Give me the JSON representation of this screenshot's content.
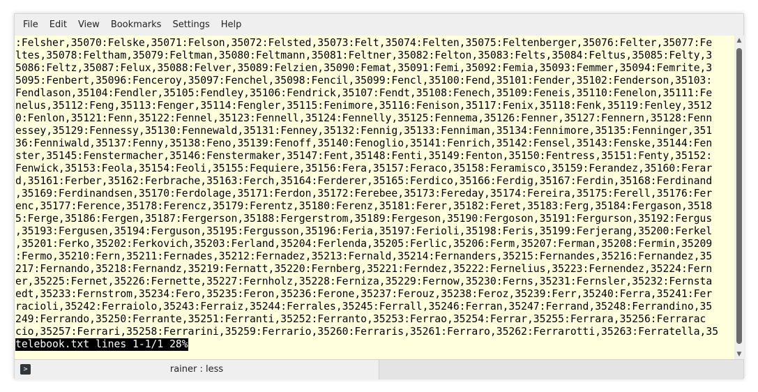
{
  "menubar": {
    "items": [
      {
        "label": "File"
      },
      {
        "label": "Edit"
      },
      {
        "label": "View"
      },
      {
        "label": "Bookmarks"
      },
      {
        "label": "Settings"
      },
      {
        "label": "Help"
      }
    ]
  },
  "terminal": {
    "lines": [
      ":Felsher,35070:Felske,35071:Felson,35072:Felsted,35073:Felt,35074:Felten,35075:Feltenberger,35076:Felter,35077:Fe",
      "ltes,35078:Feltham,35079:Feltman,35080:Feltmann,35081:Feltner,35082:Felton,35083:Felts,35084:Feltus,35085:Felty,3",
      "5086:Feltz,35087:Felux,35088:Felver,35089:Felzien,35090:Femat,35091:Femi,35092:Femia,35093:Femmer,35094:Femrite,3",
      "5095:Fenbert,35096:Fenceroy,35097:Fenchel,35098:Fencil,35099:Fencl,35100:Fend,35101:Fender,35102:Fenderson,35103:",
      "Fendlason,35104:Fendler,35105:Fendley,35106:Fendrick,35107:Fendt,35108:Fenech,35109:Feneis,35110:Fenelon,35111:Fe",
      "nelus,35112:Feng,35113:Fenger,35114:Fengler,35115:Fenimore,35116:Fenison,35117:Fenix,35118:Fenk,35119:Fenley,3512",
      "0:Fenlon,35121:Fenn,35122:Fennel,35123:Fennell,35124:Fennelly,35125:Fennema,35126:Fenner,35127:Fennern,35128:Fenn",
      "essey,35129:Fennessy,35130:Fennewald,35131:Fenney,35132:Fennig,35133:Fenniman,35134:Fennimore,35135:Fenninger,351",
      "36:Fenniwald,35137:Fenny,35138:Feno,35139:Fenoff,35140:Fenoglio,35141:Fenrich,35142:Fensel,35143:Fenske,35144:Fen",
      "ster,35145:Fenstermacher,35146:Fenstermaker,35147:Fent,35148:Fenti,35149:Fenton,35150:Fentress,35151:Fenty,35152:",
      "Fenwick,35153:Feola,35154:Feoli,35155:Fequiere,35156:Fera,35157:Feraco,35158:Feramisco,35159:Ferandez,35160:Ferar",
      "d,35161:Ferber,35162:Ferbrache,35163:Ferch,35164:Ferderer,35165:Ferdico,35166:Ferdig,35167:Ferdin,35168:Ferdinand",
      ",35169:Ferdinandsen,35170:Ferdolage,35171:Ferdon,35172:Ferebee,35173:Fereday,35174:Fereira,35175:Ferell,35176:Fer",
      "enc,35177:Ference,35178:Ferencz,35179:Ferentz,35180:Ferenz,35181:Ferer,35182:Feret,35183:Ferg,35184:Fergason,3518",
      "5:Ferge,35186:Fergen,35187:Fergerson,35188:Fergerstrom,35189:Fergeson,35190:Fergoson,35191:Fergurson,35192:Fergus",
      ",35193:Fergusen,35194:Ferguson,35195:Fergusson,35196:Feria,35197:Ferioli,35198:Feris,35199:Ferjerang,35200:Ferkel",
      ",35201:Ferko,35202:Ferkovich,35203:Ferland,35204:Ferlenda,35205:Ferlic,35206:Ferm,35207:Ferman,35208:Fermin,35209",
      ":Fermo,35210:Fern,35211:Fernades,35212:Fernadez,35213:Fernald,35214:Fernanders,35215:Fernandes,35216:Fernandez,35",
      "217:Fernando,35218:Fernandz,35219:Fernatt,35220:Fernberg,35221:Ferndez,35222:Fernelius,35223:Fernendez,35224:Fern",
      "er,35225:Fernet,35226:Fernette,35227:Fernholz,35228:Ferniza,35229:Fernow,35230:Ferns,35231:Fernsler,35232:Fernsta",
      "edt,35233:Fernstrom,35234:Fero,35235:Feron,35236:Ferone,35237:Ferouz,35238:Feroz,35239:Ferr,35240:Ferra,35241:Fer",
      "racioli,35242:Ferraiolo,35243:Ferraiz,35244:Ferrales,35245:Ferrall,35246:Ferran,35247:Ferrand,35248:Ferrandino,35",
      "249:Ferrando,35250:Ferrante,35251:Ferranti,35252:Ferranto,35253:Ferrao,35254:Ferrar,35255:Ferrara,35256:Ferrarac",
      "cio,35257:Ferrari,35258:Ferrarini,35259:Ferrario,35260:Ferraris,35261:Ferraro,35262:Ferrarotti,35263:Ferratella,35"
    ],
    "status_line": "telebook.txt lines 1-1/1 28%"
  },
  "tabbar": {
    "icon": "terminal-icon",
    "tab_title": "rainer : less"
  }
}
